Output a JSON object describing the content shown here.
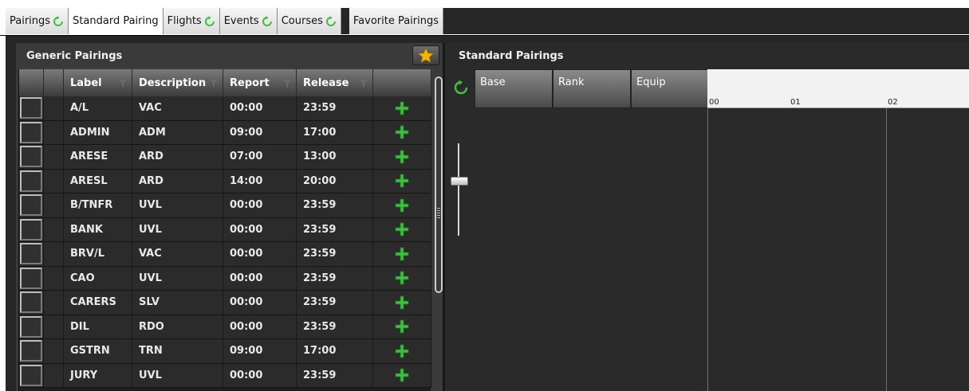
{
  "tabs": [
    {
      "label": "Pairings",
      "refresh": true,
      "active": false
    },
    {
      "label": "Standard Pairing",
      "refresh": false,
      "active": true
    },
    {
      "label": "Flights",
      "refresh": true,
      "active": false
    },
    {
      "label": "Events",
      "refresh": true,
      "active": false
    },
    {
      "label": "Courses",
      "refresh": true,
      "active": false
    }
  ],
  "favorite_tab": {
    "label": "Favorite Pairings"
  },
  "left_panel": {
    "title": "Generic Pairings",
    "favorite_icon": "star-icon",
    "columns": [
      "Label",
      "Description",
      "Report",
      "Release"
    ],
    "rows": [
      {
        "label": "A/L",
        "description": "VAC",
        "report": "00:00",
        "release": "23:59"
      },
      {
        "label": "ADMIN",
        "description": "ADM",
        "report": "09:00",
        "release": "17:00"
      },
      {
        "label": "ARESE",
        "description": "ARD",
        "report": "07:00",
        "release": "13:00"
      },
      {
        "label": "ARESL",
        "description": "ARD",
        "report": "14:00",
        "release": "20:00"
      },
      {
        "label": "B/TNFR",
        "description": "UVL",
        "report": "00:00",
        "release": "23:59"
      },
      {
        "label": "BANK",
        "description": "UVL",
        "report": "00:00",
        "release": "23:59"
      },
      {
        "label": "BRV/L",
        "description": "VAC",
        "report": "00:00",
        "release": "23:59"
      },
      {
        "label": "CAO",
        "description": "UVL",
        "report": "00:00",
        "release": "23:59"
      },
      {
        "label": "CARERS",
        "description": "SLV",
        "report": "00:00",
        "release": "23:59"
      },
      {
        "label": "DIL",
        "description": "RDO",
        "report": "00:00",
        "release": "23:59"
      },
      {
        "label": "GSTRN",
        "description": "TRN",
        "report": "09:00",
        "release": "17:00"
      },
      {
        "label": "JURY",
        "description": "UVL",
        "report": "00:00",
        "release": "23:59"
      }
    ]
  },
  "right_panel": {
    "title": "Standard Pairings",
    "columns": [
      "Base",
      "Rank",
      "Equip"
    ],
    "timeline_ticks": [
      "00",
      "01",
      "02"
    ]
  },
  "colors": {
    "accent_green": "#3fbf3f",
    "star": "#f2b700"
  }
}
